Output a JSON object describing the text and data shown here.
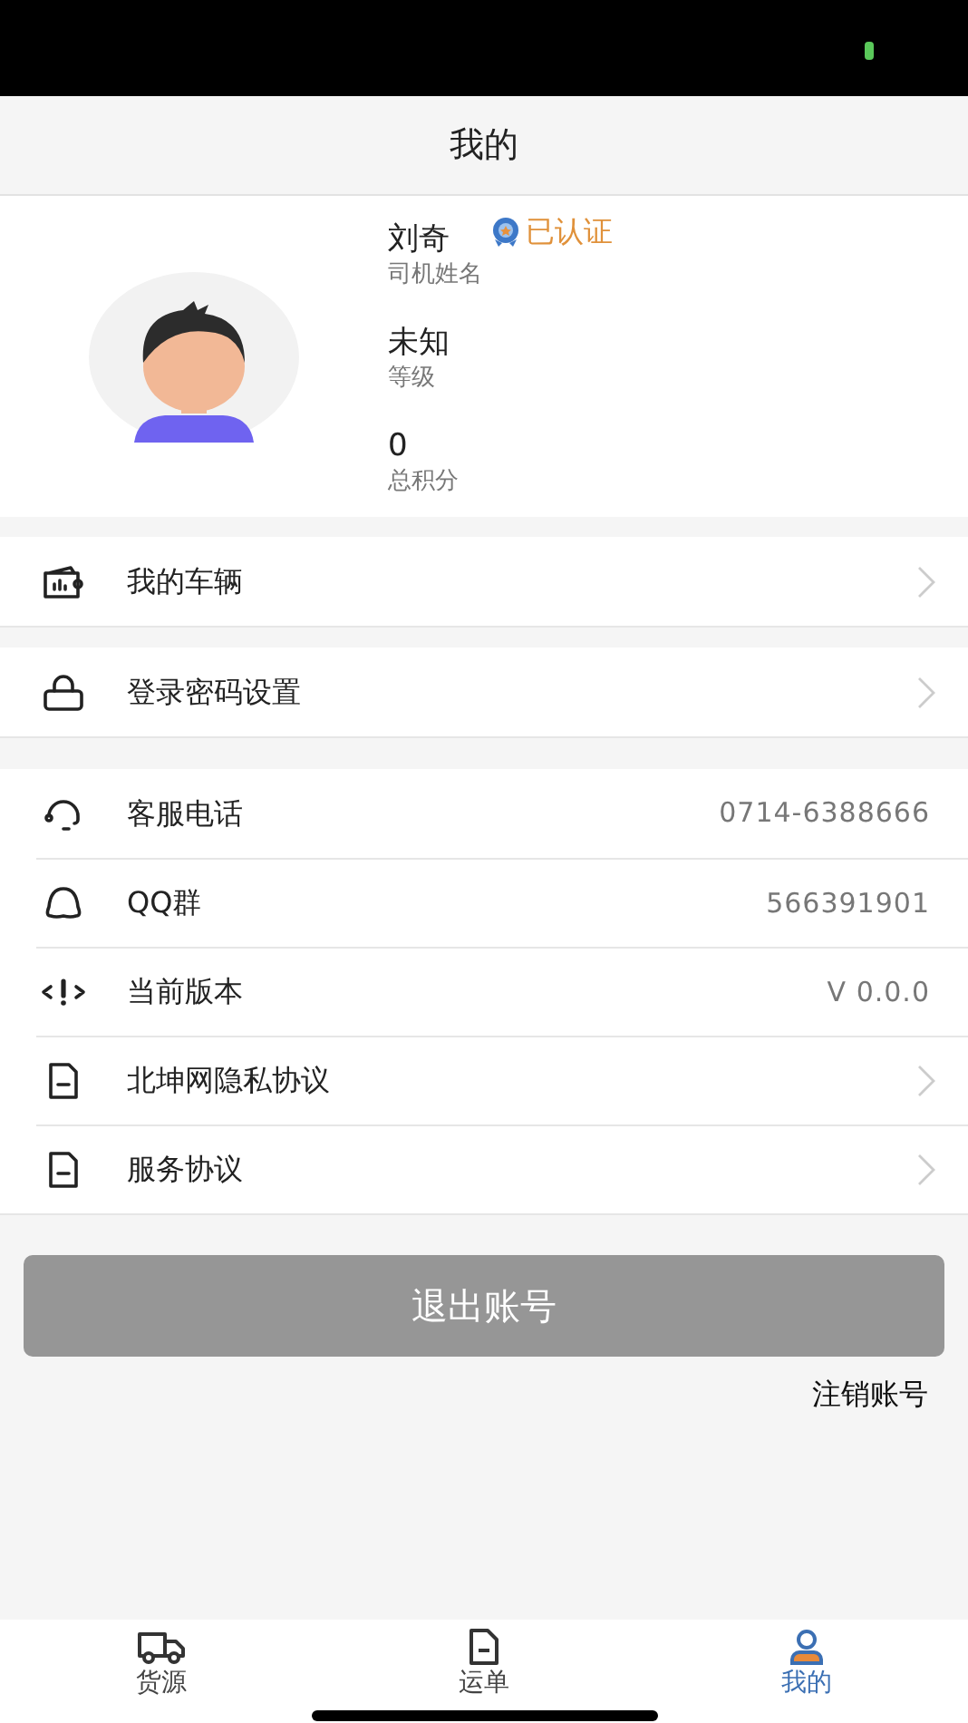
{
  "header": {
    "title": "我的"
  },
  "profile": {
    "fields": [
      {
        "value": "刘奇",
        "label": "司机姓名"
      },
      {
        "value": "未知",
        "label": "等级"
      },
      {
        "value": "0",
        "label": "总积分"
      }
    ],
    "badge": {
      "text": "已认证",
      "verified": true
    }
  },
  "menu_groups": [
    [
      {
        "label": "我的车辆",
        "kind": "link"
      }
    ],
    [
      {
        "label": "登录密码设置",
        "kind": "link"
      }
    ],
    [
      {
        "label": "客服电话",
        "kind": "value",
        "value": "0714-6388666"
      },
      {
        "label": "QQ群",
        "kind": "value",
        "value": "566391901"
      },
      {
        "label": "当前版本",
        "kind": "value",
        "value": "V 0.0.0"
      },
      {
        "label": "北坤网隐私协议",
        "kind": "link"
      },
      {
        "label": "服务协议",
        "kind": "link"
      }
    ]
  ],
  "logout_button": "退出账号",
  "deactivate_link": "注销账号",
  "tabs": [
    {
      "label": "货源",
      "selected": false
    },
    {
      "label": "运单",
      "selected": false
    },
    {
      "label": "我的",
      "selected": true
    }
  ]
}
